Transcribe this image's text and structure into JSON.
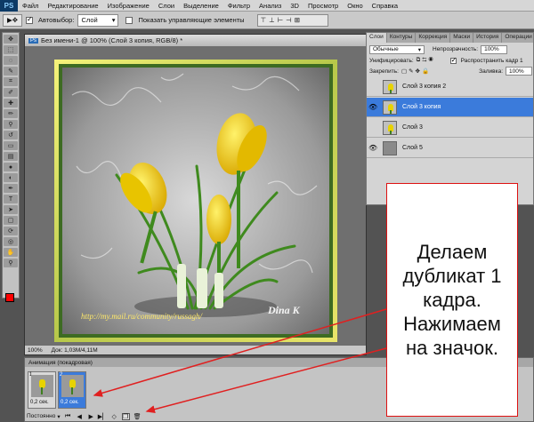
{
  "menubar": {
    "logo": "PS",
    "items": [
      "Файл",
      "Редактирование",
      "Изображение",
      "Слои",
      "Выделение",
      "Фильтр",
      "Анализ",
      "3D",
      "Просмотр",
      "Окно",
      "Справка"
    ]
  },
  "options": {
    "auto_select_label": "Автовыбор:",
    "auto_select_value": "Слой",
    "show_controls_label": "Показать управляющие элементы"
  },
  "document": {
    "title": "Без имени-1 @ 100% (Слой 3 копия, RGB/8) *",
    "zoom": "100%",
    "doc_info": "Док: 1,03M/4,11M",
    "watermark_url": "http://my.mail.ru/community/russagh/",
    "signature": "Dina K"
  },
  "layers_panel": {
    "tabs": [
      "Слои",
      "Контуры",
      "Коррекция",
      "Маски",
      "История",
      "Операции"
    ],
    "blend_mode": "Обычные",
    "opacity_label": "Непрозрачность:",
    "opacity_value": "100%",
    "unify_label": "Унифицировать:",
    "propagate_label": "Распространить кадр 1",
    "lock_label": "Закрепить:",
    "fill_label": "Заливка:",
    "fill_value": "100%",
    "layers": [
      {
        "name": "Слой 3 копия 2",
        "visible": false,
        "selected": false
      },
      {
        "name": "Слой 3 копия",
        "visible": true,
        "selected": true
      },
      {
        "name": "Слой 3",
        "visible": false,
        "selected": false
      },
      {
        "name": "Слой 5",
        "visible": true,
        "selected": false
      }
    ]
  },
  "animation_panel": {
    "title": "Анимация (покадровая)",
    "frames": [
      {
        "number": "1",
        "delay": "0,2 сек.",
        "selected": false
      },
      {
        "number": "2",
        "delay": "0,2 сек.",
        "selected": true
      }
    ],
    "loop_value": "Постоянно"
  },
  "callout": {
    "text": "Делаем дубликат 1 кадра. Нажимаем на значок."
  },
  "colors": {
    "accent_selection": "#3b7bdb",
    "arrow_red": "#e02020",
    "foreground_swatch": "#ff0000"
  }
}
